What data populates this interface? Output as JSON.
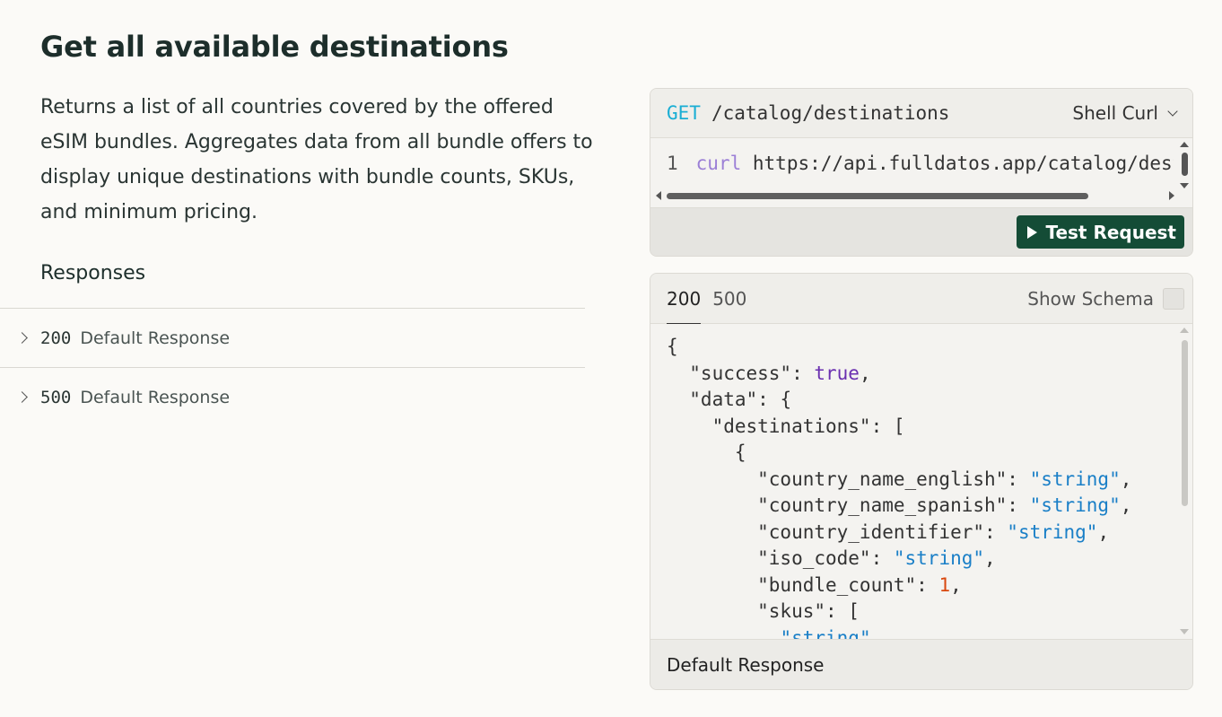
{
  "page": {
    "title": "Get all available destinations",
    "description": "Returns a list of all countries covered by the offered eSIM bundles. Aggregates data from all bundle offers to display unique destinations with bundle counts, SKUs, and minimum pricing."
  },
  "responses": {
    "heading": "Responses",
    "items": [
      {
        "code": "200",
        "label": "Default Response"
      },
      {
        "code": "500",
        "label": "Default Response"
      }
    ]
  },
  "request": {
    "method": "GET",
    "path": "/catalog/destinations",
    "language": "Shell Curl",
    "line_number": "1",
    "command": "curl",
    "url": "https://api.fulldatos.app/catalog/destinations",
    "test_button": "Test Request"
  },
  "response_panel": {
    "tabs": [
      "200",
      "500"
    ],
    "active_tab": "200",
    "show_schema_label": "Show Schema",
    "show_schema_checked": false,
    "footer_label": "Default Response",
    "json_lines": [
      "{",
      "  \"success\": true,",
      "  \"data\": {",
      "    \"destinations\": [",
      "      {",
      "        \"country_name_english\": \"string\",",
      "        \"country_name_spanish\": \"string\",",
      "        \"country_identifier\": \"string\",",
      "        \"iso_code\": \"string\",",
      "        \"bundle_count\": 1,",
      "        \"skus\": [",
      "          \"string\""
    ]
  },
  "colors": {
    "method": "#1aaed4",
    "button_bg": "#144c36",
    "json_string": "#1a7fc7",
    "json_bool": "#6a2fb0",
    "json_number": "#d9480f"
  }
}
